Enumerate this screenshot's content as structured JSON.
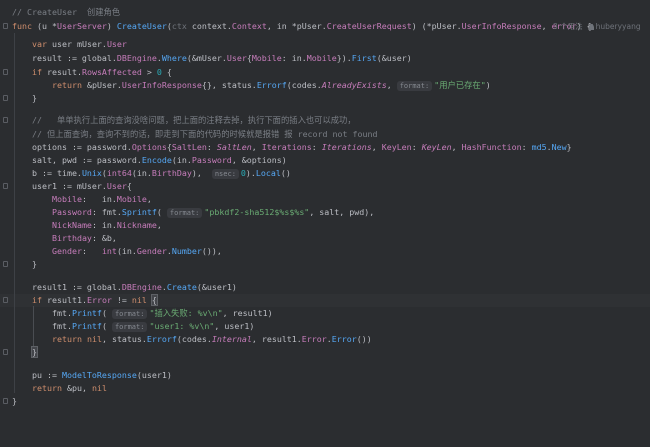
{
  "editor": {
    "author": "huberyyang",
    "usages": "3 个用法",
    "hints": {
      "format": "format:",
      "nsec": "nsec:"
    },
    "strings": {
      "already_exists": "\"用户已存在\"",
      "sprintf_fmt": "\"pbkdf2-sha512$%s$%s\"",
      "printf_fail": "\"插入失败: %v\\n\"",
      "printf_user": "\"user1: %v\\n\""
    },
    "comments": {
      "func_doc": "// CreateUser  创建角色",
      "note1": "//   单单执行上面的查询没啥问题，把上面的注释去掉，执行下面的插入也可以成功，",
      "note2": "// 但上面查询，查询不到的话，即走到下面的代码的时候就是报错 报 record not found"
    },
    "colors": {
      "background": "#2b2d30",
      "keyword": "#cf8e6d",
      "function": "#56a8f5",
      "string": "#6aab73",
      "comment": "#7a7e85",
      "field": "#c77dbb",
      "number": "#2aacb8"
    }
  }
}
